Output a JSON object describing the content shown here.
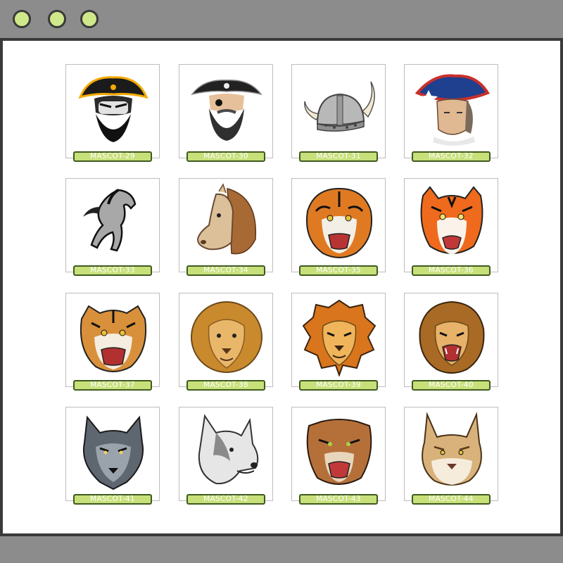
{
  "window": {
    "controls": [
      "window-dot-1",
      "window-dot-2",
      "window-dot-3"
    ]
  },
  "gallery": {
    "items": [
      {
        "label": "MASCOT-29",
        "icon": "pirate-captain-icon"
      },
      {
        "label": "MASCOT-30",
        "icon": "bearded-pirate-icon"
      },
      {
        "label": "MASCOT-31",
        "icon": "viking-helmet-icon"
      },
      {
        "label": "MASCOT-32",
        "icon": "patriot-tricorn-icon"
      },
      {
        "label": "MASCOT-33",
        "icon": "running-mustang-icon"
      },
      {
        "label": "MASCOT-34",
        "icon": "horse-head-icon"
      },
      {
        "label": "MASCOT-35",
        "icon": "roaring-tiger-icon"
      },
      {
        "label": "MASCOT-36",
        "icon": "orange-tiger-icon"
      },
      {
        "label": "MASCOT-37",
        "icon": "snarling-tiger-icon"
      },
      {
        "label": "MASCOT-38",
        "icon": "calm-lion-icon"
      },
      {
        "label": "MASCOT-39",
        "icon": "fierce-lion-icon"
      },
      {
        "label": "MASCOT-40",
        "icon": "roaring-lion-icon"
      },
      {
        "label": "MASCOT-41",
        "icon": "gray-wolf-icon"
      },
      {
        "label": "MASCOT-42",
        "icon": "white-wolf-icon"
      },
      {
        "label": "MASCOT-43",
        "icon": "cougar-icon"
      },
      {
        "label": "MASCOT-44",
        "icon": "lynx-icon"
      }
    ]
  },
  "colors": {
    "frame": "#3a3a3a",
    "bar": "#8c8c8c",
    "accent": "#c8e07a"
  }
}
